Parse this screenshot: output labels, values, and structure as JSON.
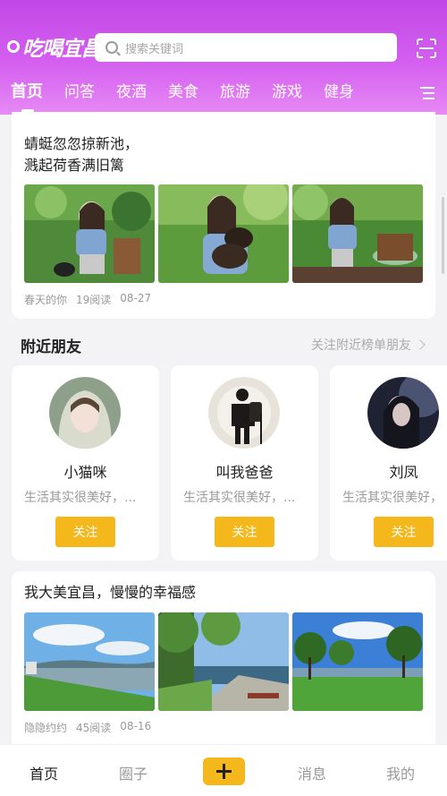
{
  "header": {
    "logo_text": "吃喝宜昌",
    "search_placeholder": "搜索关键词"
  },
  "tabs": [
    "首页",
    "问答",
    "夜酒",
    "美食",
    "旅游",
    "游戏",
    "健身"
  ],
  "active_tab": 0,
  "post1": {
    "title_line1": "蜻蜓忽忽掠新池，",
    "title_line2": "溅起荷香满旧篱",
    "author": "春天的你",
    "reads": "19阅读",
    "date": "08-27"
  },
  "nearby": {
    "title": "附近朋友",
    "link": "关注附近榜单朋友",
    "friends": [
      {
        "name": "小猫咪",
        "bio": "生活其实很美好，...",
        "button": "关注"
      },
      {
        "name": "叫我爸爸",
        "bio": "生活其实很美好，...",
        "button": "关注"
      },
      {
        "name": "刘凤",
        "bio": "生活其实很美好，",
        "button": "关注"
      }
    ]
  },
  "post2": {
    "title": "我大美宜昌，慢慢的幸福感",
    "author": "隐隐约约",
    "reads": "45阅读",
    "date": "08-16"
  },
  "bottom_nav": {
    "home": "首页",
    "circle": "圈子",
    "messages": "消息",
    "mine": "我的"
  },
  "colors": {
    "header_top": "#c248e6",
    "header_bottom": "#e78af5",
    "accent": "#f5b81c"
  }
}
